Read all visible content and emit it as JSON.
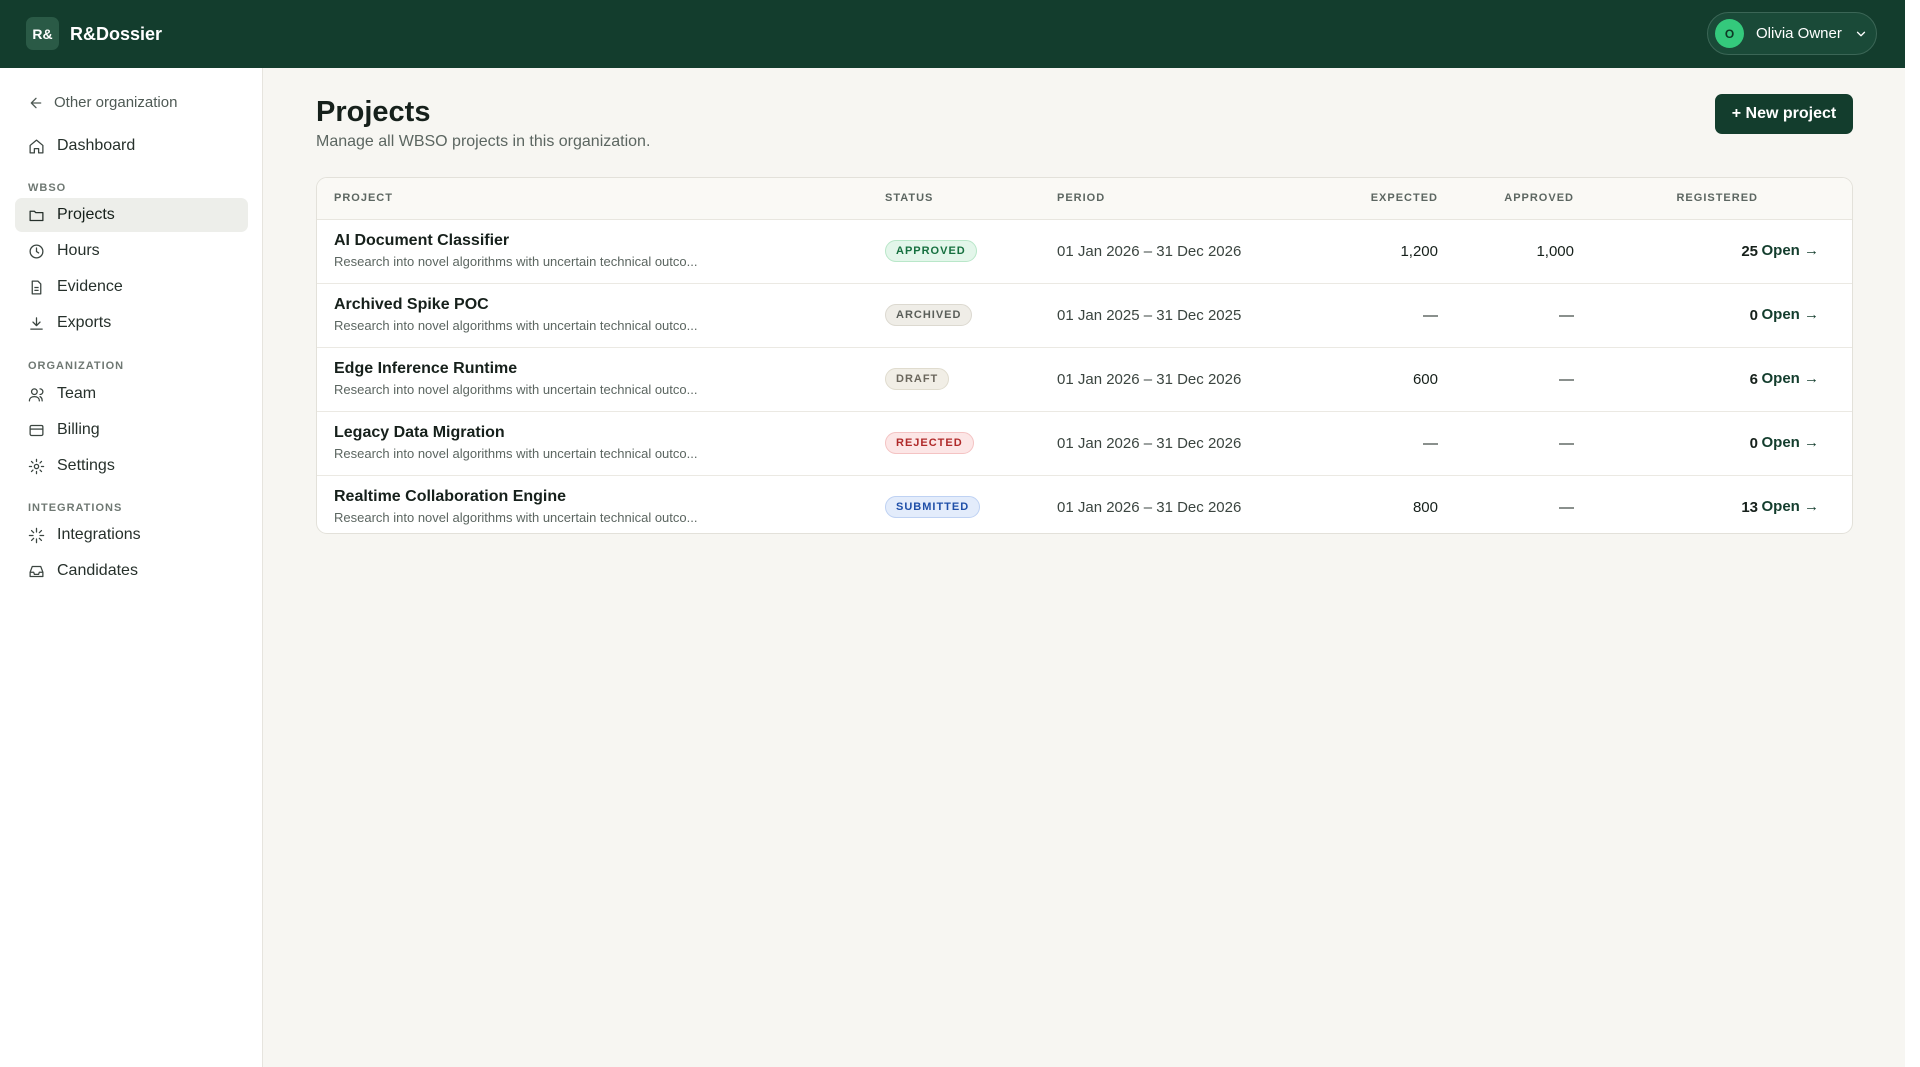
{
  "header": {
    "logo_text": "R&",
    "app_title": "R&Dossier",
    "user": {
      "initial": "O",
      "name": "Olivia Owner"
    }
  },
  "sidebar": {
    "back_label": "Other organization",
    "dashboard_label": "Dashboard",
    "sections": [
      {
        "label": "WBSO",
        "items": [
          {
            "label": "Projects",
            "icon": "folder-icon",
            "active": true
          },
          {
            "label": "Hours",
            "icon": "clock-icon"
          },
          {
            "label": "Evidence",
            "icon": "document-icon"
          },
          {
            "label": "Exports",
            "icon": "download-icon"
          }
        ]
      },
      {
        "label": "ORGANIZATION",
        "items": [
          {
            "label": "Team",
            "icon": "users-icon"
          },
          {
            "label": "Billing",
            "icon": "credit-card-icon"
          },
          {
            "label": "Settings",
            "icon": "gear-icon"
          }
        ]
      },
      {
        "label": "INTEGRATIONS",
        "items": [
          {
            "label": "Integrations",
            "icon": "spark-icon"
          },
          {
            "label": "Candidates",
            "icon": "inbox-icon"
          }
        ]
      }
    ]
  },
  "main": {
    "title": "Projects",
    "subtitle": "Manage all WBSO projects in this organization.",
    "new_button": "+ New project",
    "table": {
      "columns": [
        "PROJECT",
        "STATUS",
        "PERIOD",
        "EXPECTED",
        "APPROVED",
        "REGISTERED"
      ],
      "open_label": "Open →",
      "rows": [
        {
          "name": "AI Document Classifier",
          "desc": "Research into novel algorithms with uncertain technical outco...",
          "status": "APPROVED",
          "period": "01 Jan 2026 – 31 Dec 2026",
          "expected": "1,200",
          "approved": "1,000",
          "registered": "25"
        },
        {
          "name": "Archived Spike POC",
          "desc": "Research into novel algorithms with uncertain technical outco...",
          "status": "ARCHIVED",
          "period": "01 Jan 2025 – 31 Dec 2025",
          "expected": "—",
          "approved": "—",
          "registered": "0"
        },
        {
          "name": "Edge Inference Runtime",
          "desc": "Research into novel algorithms with uncertain technical outco...",
          "status": "DRAFT",
          "period": "01 Jan 2026 – 31 Dec 2026",
          "expected": "600",
          "approved": "—",
          "registered": "6"
        },
        {
          "name": "Legacy Data Migration",
          "desc": "Research into novel algorithms with uncertain technical outco...",
          "status": "REJECTED",
          "period": "01 Jan 2026 – 31 Dec 2026",
          "expected": "—",
          "approved": "—",
          "registered": "0"
        },
        {
          "name": "Realtime Collaboration Engine",
          "desc": "Research into novel algorithms with uncertain technical outco...",
          "status": "SUBMITTED",
          "period": "01 Jan 2026 – 31 Dec 2026",
          "expected": "800",
          "approved": "—",
          "registered": "13"
        }
      ]
    }
  },
  "colors": {
    "brand": "#133d2d",
    "avatar": "#34c97c",
    "approved": "#16703f",
    "rejected": "#b02a2a",
    "submitted": "#1f4fa8"
  }
}
